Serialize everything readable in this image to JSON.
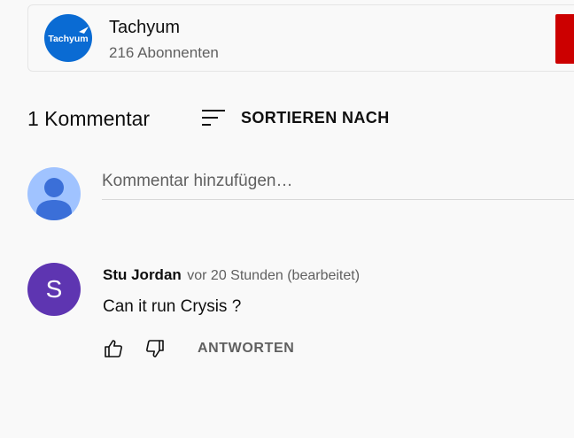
{
  "channel": {
    "logo_text": "Tachyum",
    "name": "Tachyum",
    "subscribers": "216 Abonnenten",
    "logo_color": "#0a6bd3",
    "subscribe_color": "#cc0000"
  },
  "comments_header": {
    "count_label": "1 Kommentar",
    "sort_label": "SORTIEREN NACH",
    "sort_icon": "sort-icon"
  },
  "add_comment": {
    "placeholder": "Kommentar hinzufügen…",
    "avatar_icon": "default-user-icon",
    "avatar_color": "#a0c3ff"
  },
  "comments": [
    {
      "avatar_letter": "S",
      "avatar_color": "#5e35b1",
      "author": "Stu Jordan",
      "time": "vor 20 Stunden (bearbeitet)",
      "text": "Can it run Crysis ?",
      "like_icon": "thumbs-up-icon",
      "dislike_icon": "thumbs-down-icon",
      "reply_label": "ANTWORTEN"
    }
  ]
}
